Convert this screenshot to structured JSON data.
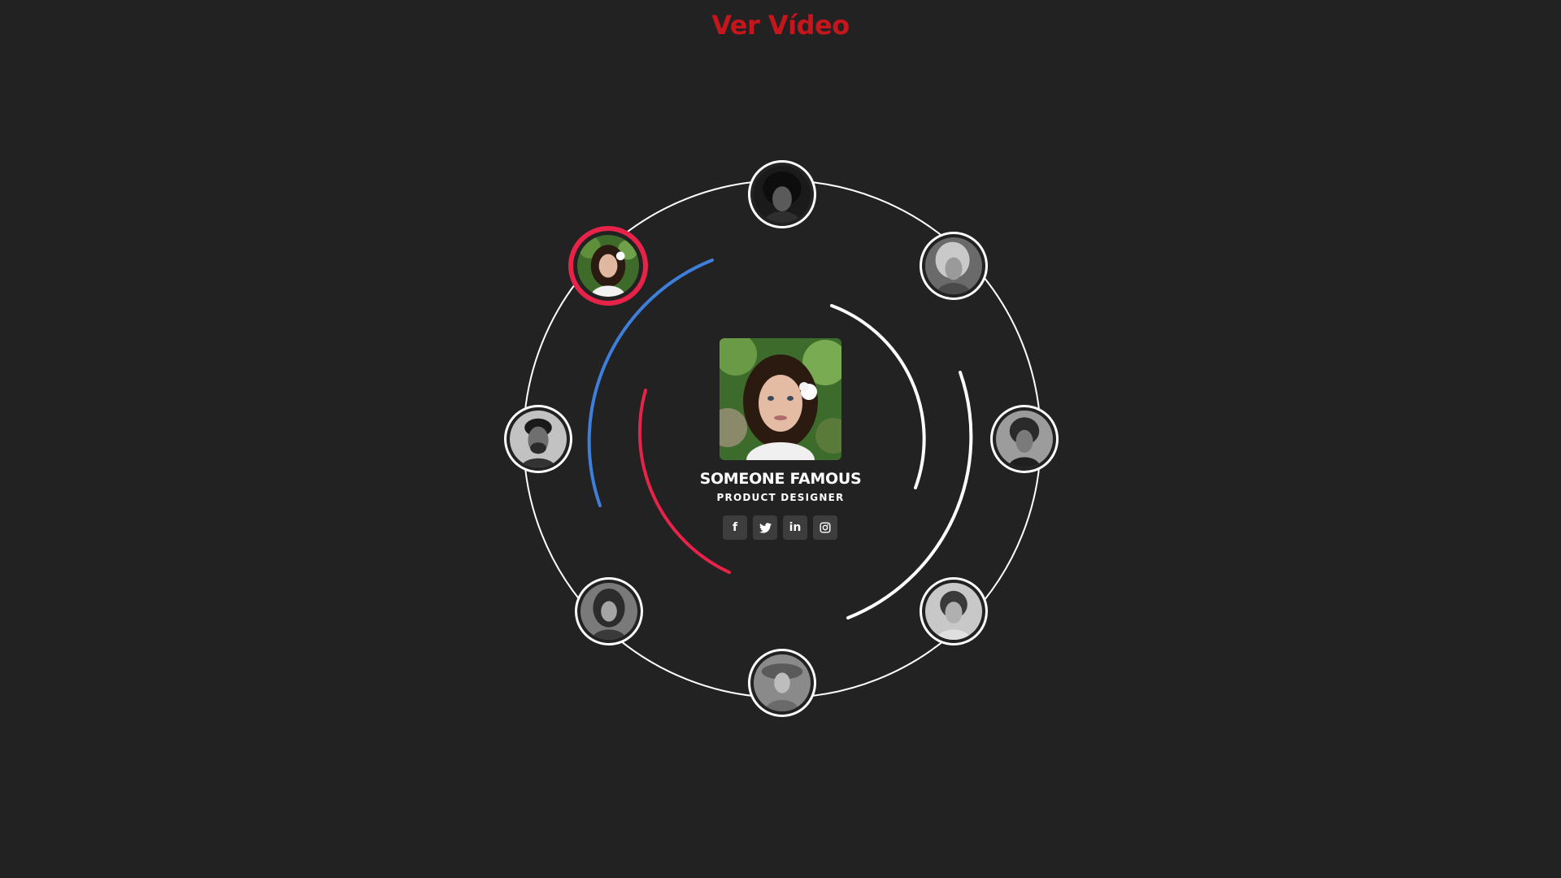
{
  "header": {
    "link_label": "Ver Vídeo",
    "link_color": "#c4161c"
  },
  "profile": {
    "name": "SOMEONE FAMOUS",
    "role": "PRODUCT DESIGNER",
    "socials": [
      {
        "icon": "facebook-icon",
        "glyph": "f"
      },
      {
        "icon": "twitter-icon",
        "glyph": "🐦"
      },
      {
        "icon": "linkedin-icon",
        "glyph": "in"
      },
      {
        "icon": "instagram-icon",
        "glyph": "◎"
      }
    ]
  },
  "avatars": [
    {
      "id": "top",
      "active": false
    },
    {
      "id": "top-right",
      "active": false
    },
    {
      "id": "right",
      "active": false
    },
    {
      "id": "bottom-right",
      "active": false
    },
    {
      "id": "bottom",
      "active": false
    },
    {
      "id": "bottom-left",
      "active": false
    },
    {
      "id": "left",
      "active": false
    },
    {
      "id": "top-left",
      "active": true
    }
  ],
  "colors": {
    "background": "#222222",
    "ring": "#ffffff",
    "accent_red": "#e8234a",
    "accent_blue": "#3f7fdc",
    "social_bg": "#3d3d3d"
  }
}
